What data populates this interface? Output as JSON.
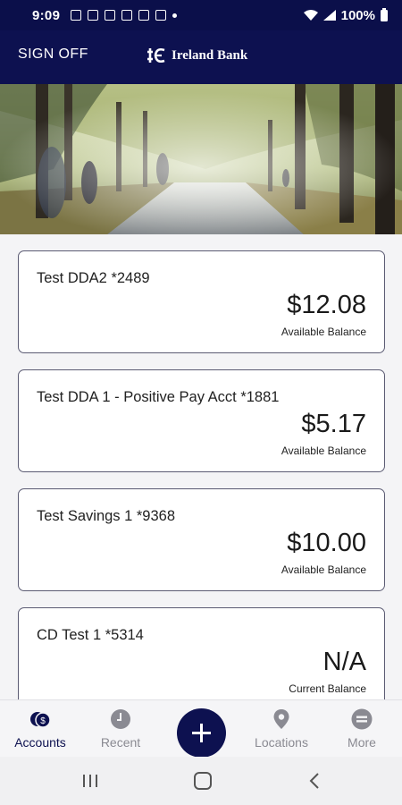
{
  "status_bar": {
    "time": "9:09",
    "battery": "100%"
  },
  "header": {
    "sign_off": "SIGN OFF",
    "bank_name": "Ireland Bank",
    "brand_color": "#0d1150"
  },
  "accounts": [
    {
      "name": "Test DDA2 *2489",
      "amount": "$12.08",
      "label": "Available Balance"
    },
    {
      "name": "Test DDA 1 - Positive Pay Acct *1881",
      "amount": "$5.17",
      "label": "Available Balance"
    },
    {
      "name": "Test Savings 1 *9368",
      "amount": "$10.00",
      "label": "Available Balance"
    },
    {
      "name": "CD Test 1 *5314",
      "amount": "N/A",
      "label": "Current Balance"
    }
  ],
  "bottom_nav": {
    "items": [
      {
        "label": "Accounts",
        "icon": "accounts-icon",
        "active": true
      },
      {
        "label": "Recent",
        "icon": "clock-icon"
      },
      {
        "label": "Locations",
        "icon": "location-pin-icon"
      },
      {
        "label": "More",
        "icon": "more-menu-icon"
      }
    ],
    "fab_icon": "plus-icon"
  },
  "system_nav": {
    "icons": [
      "recent-apps-icon",
      "home-icon",
      "back-icon"
    ]
  }
}
